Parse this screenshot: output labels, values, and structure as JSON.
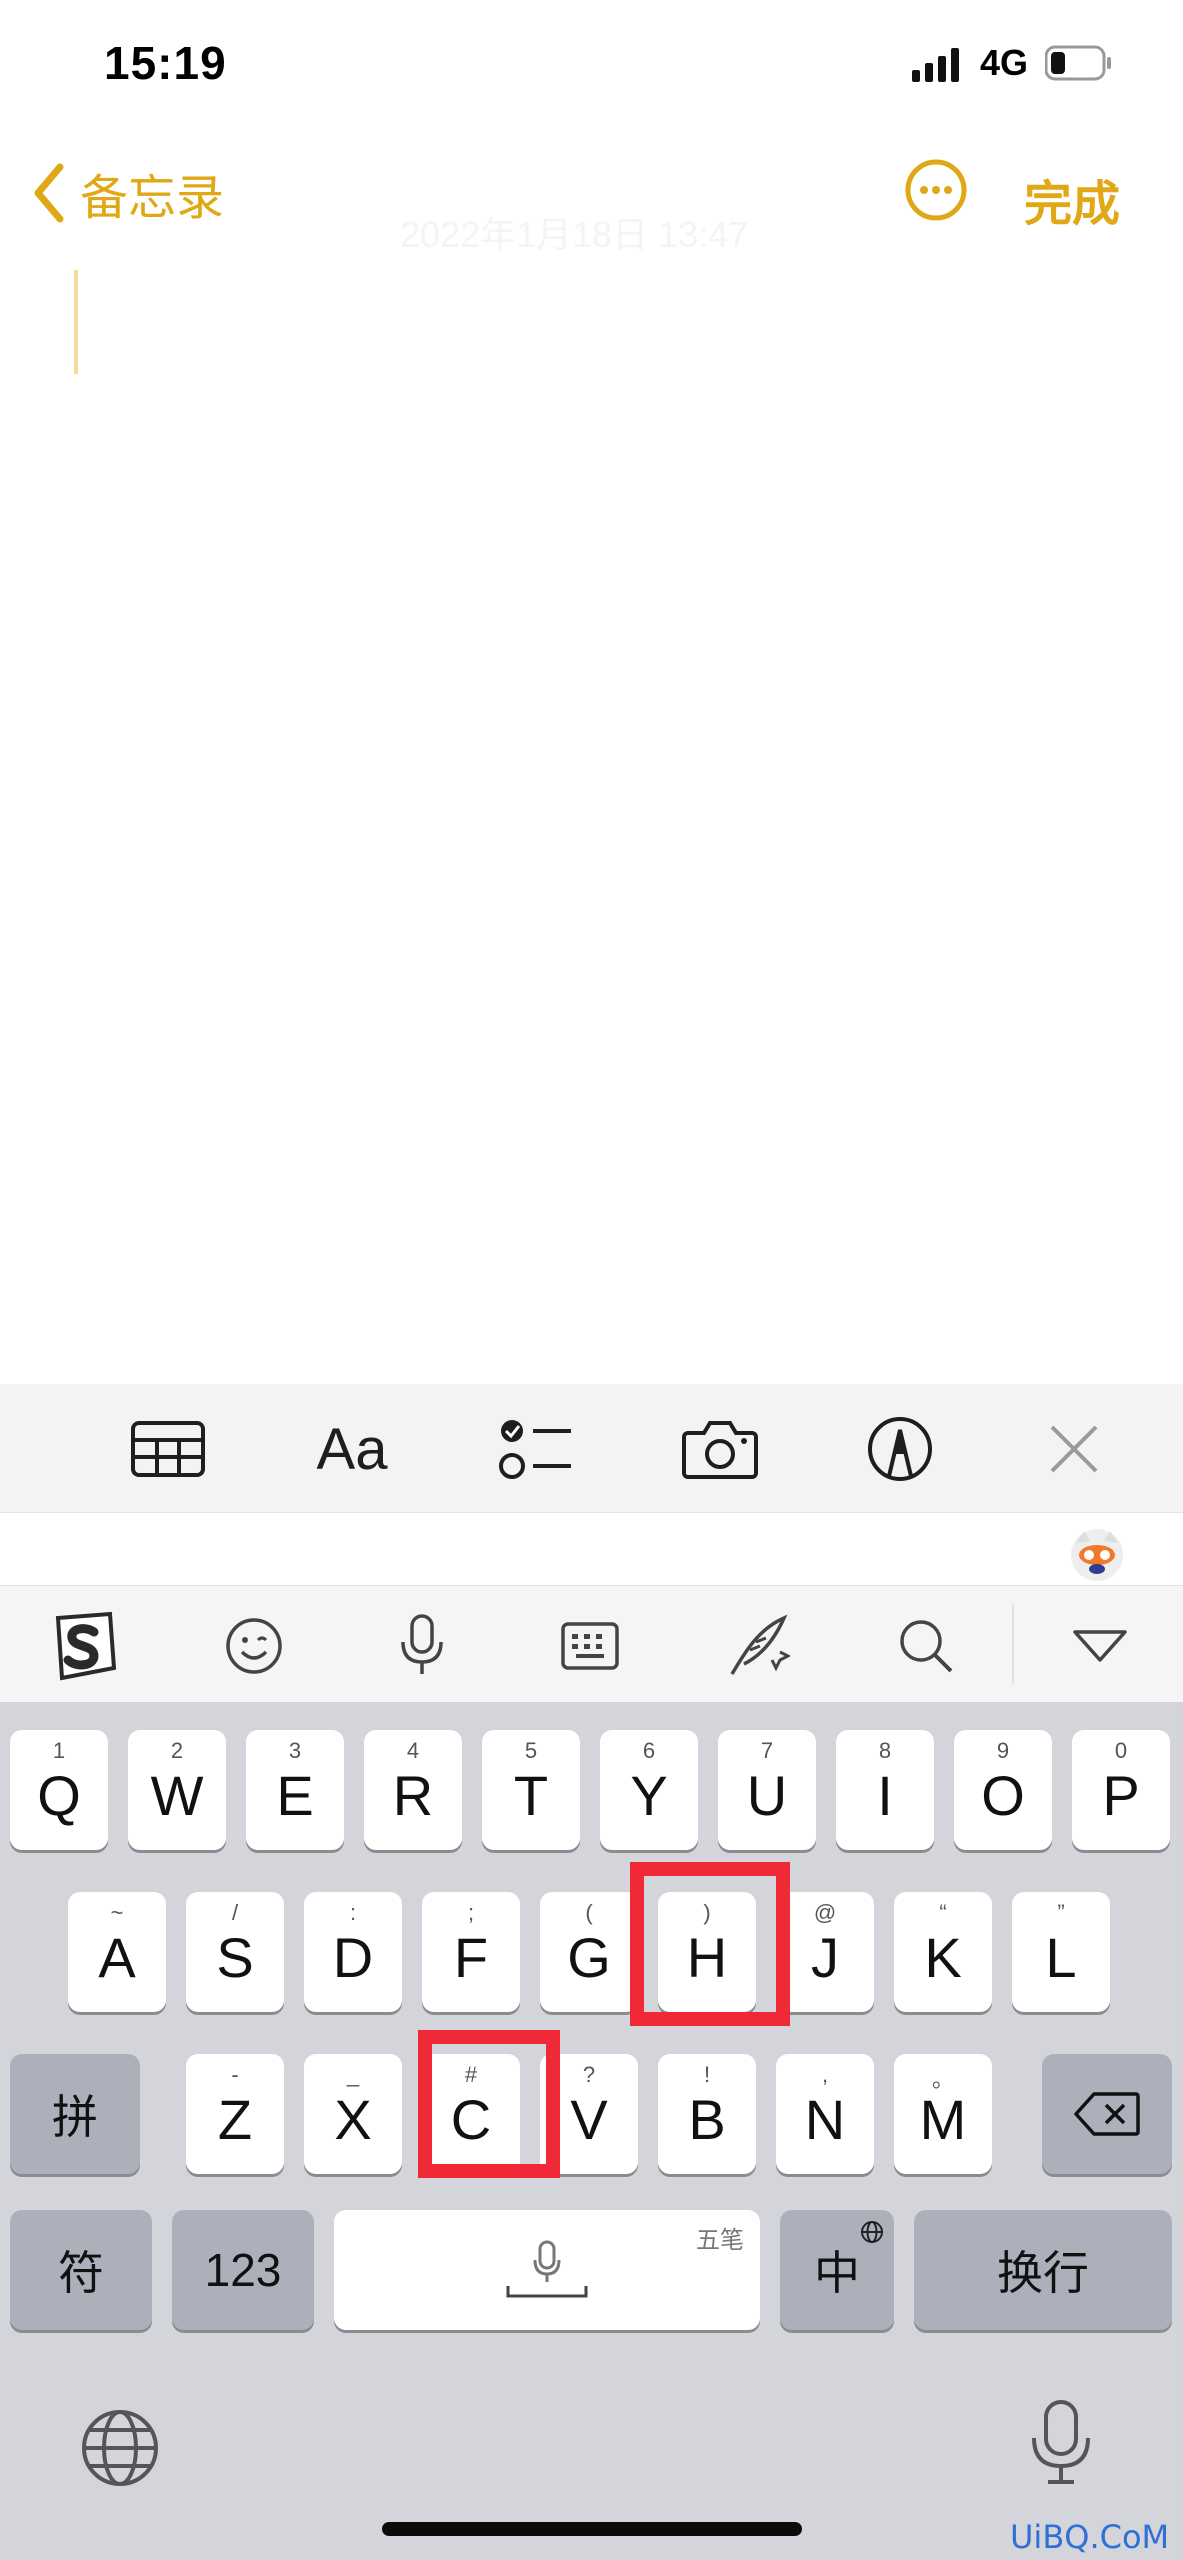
{
  "status_bar": {
    "time": "15:19",
    "network": "4G"
  },
  "nav": {
    "back_label": "备忘录",
    "done_label": "完成",
    "date": "2022年1月18日 13:47"
  },
  "notes_toolbar": {
    "items": [
      "table-icon",
      "Aa",
      "checklist-icon",
      "camera-icon",
      "markup-icon",
      "close-icon"
    ],
    "format_label": "Aa"
  },
  "ime_toolbar": {
    "items": [
      "sogou-logo-icon",
      "emoji-icon",
      "microphone-icon",
      "keyboard-icon",
      "handwriting-icon",
      "search-icon",
      "collapse-icon"
    ]
  },
  "keyboard": {
    "row1": [
      {
        "letter": "Q",
        "hint": "1"
      },
      {
        "letter": "W",
        "hint": "2"
      },
      {
        "letter": "E",
        "hint": "3"
      },
      {
        "letter": "R",
        "hint": "4"
      },
      {
        "letter": "T",
        "hint": "5"
      },
      {
        "letter": "Y",
        "hint": "6"
      },
      {
        "letter": "U",
        "hint": "7"
      },
      {
        "letter": "I",
        "hint": "8"
      },
      {
        "letter": "O",
        "hint": "9"
      },
      {
        "letter": "P",
        "hint": "0"
      }
    ],
    "row2": [
      {
        "letter": "A",
        "hint": "~"
      },
      {
        "letter": "S",
        "hint": "/"
      },
      {
        "letter": "D",
        "hint": ":"
      },
      {
        "letter": "F",
        "hint": ";"
      },
      {
        "letter": "G",
        "hint": "("
      },
      {
        "letter": "H",
        "hint": ")"
      },
      {
        "letter": "J",
        "hint": "@"
      },
      {
        "letter": "K",
        "hint": "“"
      },
      {
        "letter": "L",
        "hint": "”"
      }
    ],
    "row3": [
      {
        "letter": "Z",
        "hint": "-"
      },
      {
        "letter": "X",
        "hint": "_"
      },
      {
        "letter": "C",
        "hint": "#"
      },
      {
        "letter": "V",
        "hint": "?"
      },
      {
        "letter": "B",
        "hint": "!"
      },
      {
        "letter": "N",
        "hint": ","
      },
      {
        "letter": "M",
        "hint": "。"
      }
    ],
    "pinyin_label": "拼",
    "symbol_label": "符",
    "numbers_label": "123",
    "space_hint": "五笔",
    "lang_label": "中",
    "return_label": "换行",
    "highlighted_keys": [
      "H",
      "C"
    ],
    "highlight_color": "#ef2a36"
  },
  "accent_color": "#e0a816",
  "watermark": "UiBQ.CoM"
}
